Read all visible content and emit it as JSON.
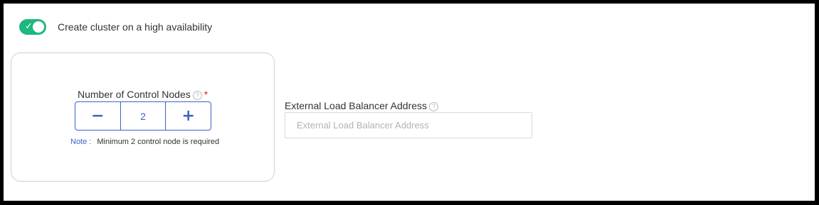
{
  "ha_toggle": {
    "label": "Create cluster on a high availability",
    "checked": true,
    "check_glyph": "✓",
    "color": "#1db87d"
  },
  "control_nodes": {
    "label": "Number of Control Nodes",
    "help_glyph": "?",
    "required_mark": "*",
    "minus_glyph": "−",
    "plus_glyph": "+",
    "value": "2",
    "note_label": "Note :",
    "note_text": "Minimum 2 control node is required",
    "accent_color": "#3d63c9"
  },
  "external_lb": {
    "label": "External Load Balancer Address",
    "help_glyph": "?",
    "value": "",
    "placeholder": "External Load Balancer Address"
  }
}
